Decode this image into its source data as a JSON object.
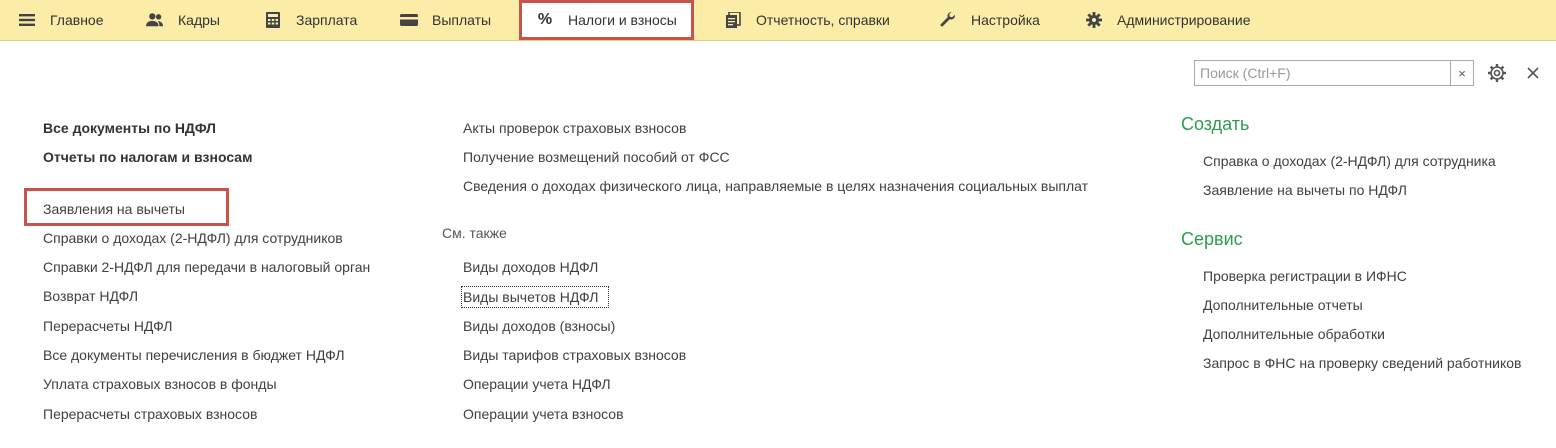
{
  "nav": {
    "items": [
      {
        "label": "Главное",
        "icon": "menu-icon"
      },
      {
        "label": "Кадры",
        "icon": "people-icon"
      },
      {
        "label": "Зарплата",
        "icon": "calculator-icon"
      },
      {
        "label": "Выплаты",
        "icon": "wallet-icon"
      },
      {
        "label": "Налоги и взносы",
        "icon": "percent-icon"
      },
      {
        "label": "Отчетность, справки",
        "icon": "documents-icon"
      },
      {
        "label": "Настройка",
        "icon": "wrench-icon"
      },
      {
        "label": "Администрирование",
        "icon": "gear-icon"
      }
    ],
    "active": "Налоги и взносы"
  },
  "search": {
    "placeholder": "Поиск (Ctrl+F)",
    "value": "",
    "clear": "×"
  },
  "colors": {
    "topbar": "#fbeda7",
    "highlight": "#c9524a",
    "section": "#2e9c4d"
  },
  "col1": {
    "bold_links": [
      "Все документы по НДФЛ",
      "Отчеты по налогам и взносам"
    ],
    "links": [
      "Заявления на вычеты",
      "Справки о доходах (2-НДФЛ) для сотрудников",
      "Справки 2-НДФЛ для передачи в налоговый орган",
      "Возврат НДФЛ",
      "Перерасчеты НДФЛ",
      "Все документы перечисления в бюджет НДФЛ",
      "Уплата страховых взносов в фонды",
      "Перерасчеты страховых взносов"
    ]
  },
  "col2": {
    "links": [
      "Акты проверок страховых взносов",
      "Получение возмещений пособий от ФСС",
      "Сведения о доходах физического лица, направляемые в целях назначения социальных выплат"
    ],
    "see_also_label": "См. также",
    "see_also": [
      "Виды доходов НДФЛ",
      "Виды вычетов НДФЛ",
      "Виды доходов (взносы)",
      "Виды тарифов страховых взносов",
      "Операции учета НДФЛ",
      "Операции учета взносов"
    ]
  },
  "col3": {
    "create_title": "Создать",
    "create": [
      "Справка о доходах (2-НДФЛ) для сотрудника",
      "Заявление на вычеты по НДФЛ"
    ],
    "service_title": "Сервис",
    "service": [
      "Проверка регистрации в ИФНС",
      "Дополнительные отчеты",
      "Дополнительные обработки",
      "Запрос в ФНС на проверку сведений работников"
    ]
  }
}
